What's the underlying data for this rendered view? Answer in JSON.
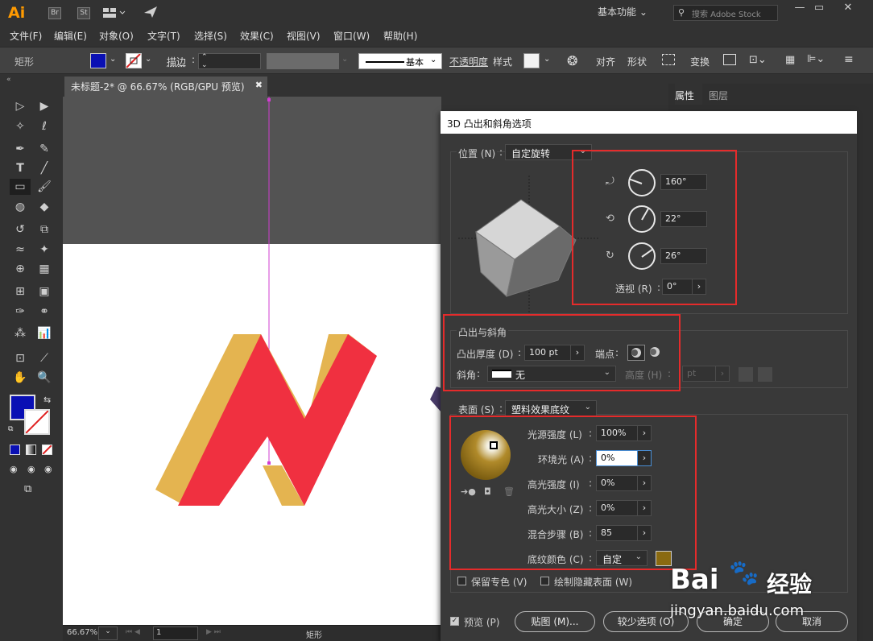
{
  "app": {
    "logo": "Ai",
    "badges": [
      "Br",
      "St"
    ],
    "workspace": "基本功能",
    "search_placeholder": "搜索 Adobe Stock"
  },
  "menu": [
    "文件(F)",
    "编辑(E)",
    "对象(O)",
    "文字(T)",
    "选择(S)",
    "效果(C)",
    "视图(V)",
    "窗口(W)",
    "帮助(H)"
  ],
  "control": {
    "object_label": "矩形",
    "stroke_label": "描边",
    "stroke_profile": "基本",
    "opacity_label": "不透明度",
    "style_label": "样式",
    "align_label": "对齐",
    "shape_label": "形状",
    "transform_label": "变换"
  },
  "document": {
    "tab_title": "未标题-2* @ 66.67% (RGB/GPU 预览)",
    "zoom": "66.67%",
    "page": "1",
    "status_tool": "矩形"
  },
  "right_panel": {
    "tabs": [
      "属性",
      "图层"
    ]
  },
  "dialog": {
    "title": "3D 凸出和斜角选项",
    "position_label": "位置 (N)",
    "position_value": "自定旋转",
    "rot_x": "160°",
    "rot_y": "22°",
    "rot_z": "26°",
    "perspective_label": "透视 (R)",
    "perspective_value": "0°",
    "extrude_section": "凸出与斜角",
    "extrude_depth_label": "凸出厚度 (D)",
    "extrude_depth_value": "100 pt",
    "cap_label": "端点",
    "bevel_label": "斜角",
    "bevel_value": "无",
    "height_label": "高度 (H)",
    "height_value": "pt",
    "surface_label": "表面 (S)",
    "surface_value": "塑料效果底纹",
    "light_intensity_label": "光源强度 (L)",
    "light_intensity_value": "100%",
    "ambient_label": "环境光 (A)",
    "ambient_value": "0%",
    "highlight_intensity_label": "高光强度 (I)",
    "highlight_intensity_value": "0%",
    "highlight_size_label": "高光大小 (Z)",
    "highlight_size_value": "0%",
    "blend_steps_label": "混合步骤 (B)",
    "blend_steps_value": "85",
    "shading_color_label": "底纹颜色 (C)",
    "shading_color_value": "自定",
    "preserve_spot_label": "保留专色 (V)",
    "draw_hidden_label": "绘制隐藏表面 (W)",
    "preview_label": "预览 (P)",
    "map_button": "贴图 (M)...",
    "fewer_button": "较少选项 (O)",
    "ok_button": "确定",
    "cancel_button": "取消"
  },
  "colors": {
    "fill": "#0a10b4",
    "shading": "#8a6a10",
    "logo_front": "#f03040",
    "logo_side": "#e4b450",
    "highlight_box": "#e52b2b"
  },
  "watermark": {
    "brand": "Bai",
    "brand2": "经验",
    "url": "jingyan.baidu.com"
  }
}
